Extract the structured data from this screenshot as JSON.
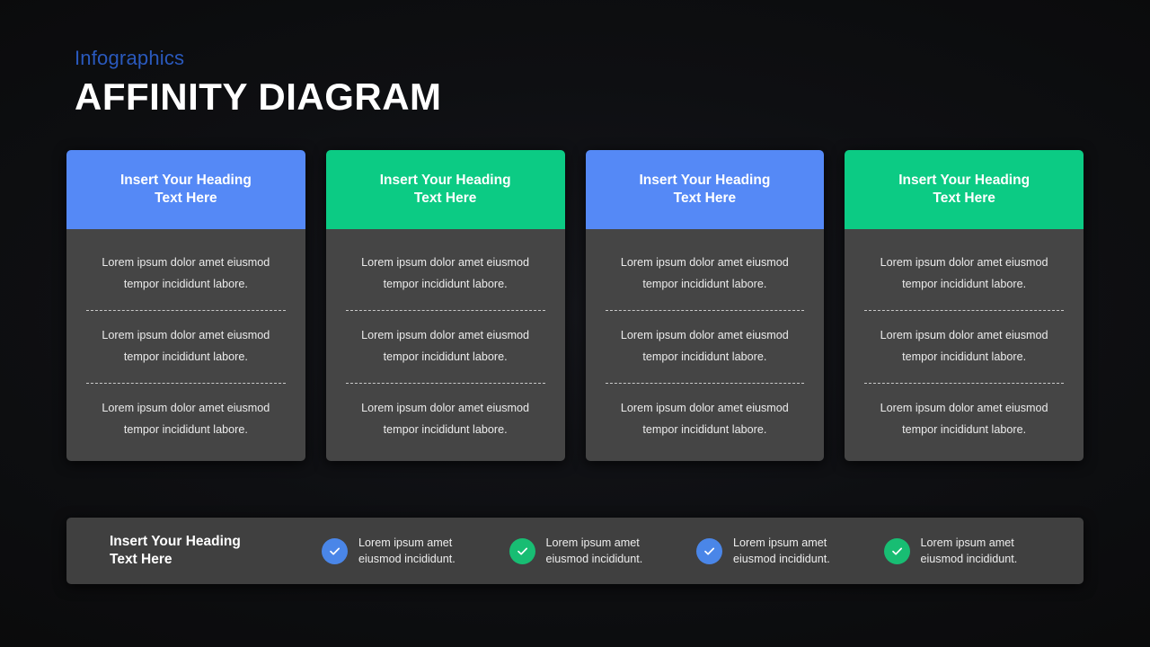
{
  "header": {
    "eyebrow": "Infographics",
    "title": "AFFINITY DIAGRAM"
  },
  "colors": {
    "background": "#0b0b0d",
    "blue": "#5589f6",
    "green": "#0ccb84",
    "card_body": "#454545",
    "legend_bar": "#404040",
    "eyebrow": "#2a59bd",
    "title": "#ffffff",
    "divider": "#c9c9c9",
    "check_blue": "#4a86e8",
    "check_green": "#18bd73"
  },
  "cards": [
    {
      "heading": "Insert Your Heading\nText Here",
      "accent": "blue",
      "items": [
        "Lorem ipsum dolor amet eiusmod tempor incididunt  labore.",
        "Lorem ipsum dolor amet eiusmod tempor incididunt  labore.",
        "Lorem ipsum dolor amet eiusmod tempor incididunt  labore."
      ]
    },
    {
      "heading": "Insert Your Heading\nText Here",
      "accent": "green",
      "items": [
        "Lorem ipsum dolor amet eiusmod tempor incididunt  labore.",
        "Lorem ipsum dolor amet eiusmod tempor incididunt  labore.",
        "Lorem ipsum dolor amet eiusmod tempor incididunt  labore."
      ]
    },
    {
      "heading": "Insert Your Heading\nText Here",
      "accent": "blue",
      "items": [
        "Lorem ipsum dolor amet eiusmod tempor incididunt  labore.",
        "Lorem ipsum dolor amet eiusmod tempor incididunt  labore.",
        "Lorem ipsum dolor amet eiusmod tempor incididunt  labore."
      ]
    },
    {
      "heading": "Insert Your Heading\nText Here",
      "accent": "green",
      "items": [
        "Lorem ipsum dolor amet eiusmod tempor incididunt  labore.",
        "Lorem ipsum dolor amet eiusmod tempor incididunt  labore.",
        "Lorem ipsum dolor amet eiusmod tempor incididunt  labore."
      ]
    }
  ],
  "legend": {
    "title": "Insert Your Heading\nText Here",
    "items": [
      {
        "icon": "check-circle-icon",
        "accent": "blue",
        "text": "Lorem ipsum amet\neiusmod incididunt."
      },
      {
        "icon": "check-circle-icon",
        "accent": "green",
        "text": "Lorem ipsum amet\neiusmod incididunt."
      },
      {
        "icon": "check-circle-icon",
        "accent": "blue",
        "text": "Lorem ipsum amet\neiusmod incididunt."
      },
      {
        "icon": "check-circle-icon",
        "accent": "green",
        "text": "Lorem ipsum amet\neiusmod incididunt."
      }
    ]
  }
}
